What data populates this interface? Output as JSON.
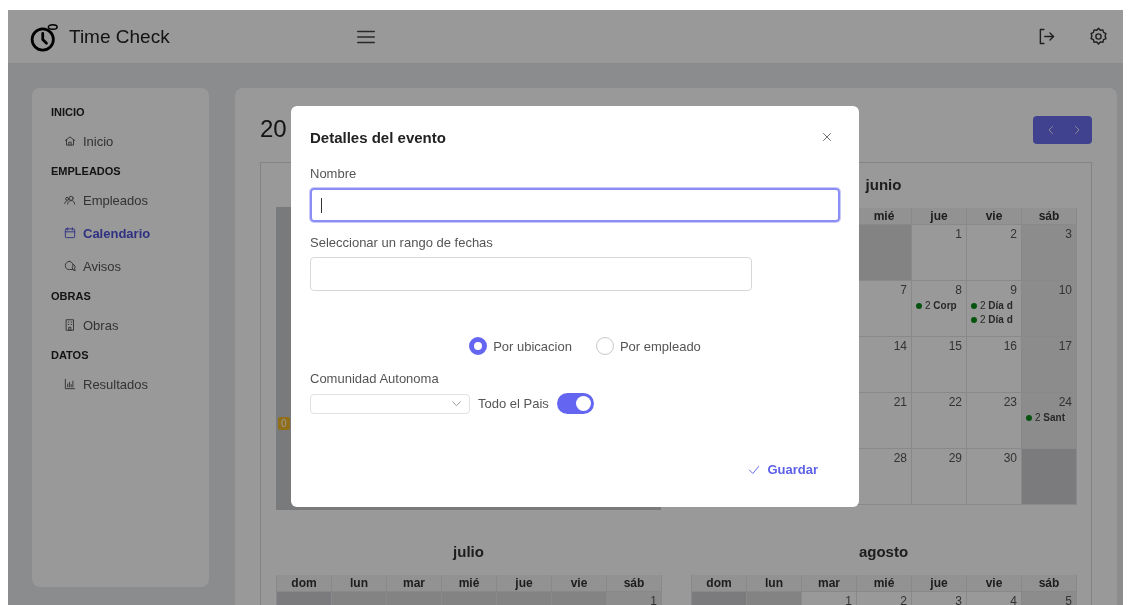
{
  "header": {
    "title": "Time Check"
  },
  "sidebar": {
    "sections": [
      {
        "heading": "INICIO",
        "items": [
          {
            "label": "Inicio",
            "selected": false
          }
        ]
      },
      {
        "heading": "EMPLEADOS",
        "items": [
          {
            "label": "Empleados",
            "selected": false
          },
          {
            "label": "Calendario",
            "selected": true
          },
          {
            "label": "Avisos",
            "selected": false
          }
        ]
      },
      {
        "heading": "OBRAS",
        "items": [
          {
            "label": "Obras",
            "selected": false
          }
        ]
      },
      {
        "heading": "DATOS",
        "items": [
          {
            "label": "Resultados",
            "selected": false
          }
        ]
      }
    ]
  },
  "main": {
    "year_title": "20"
  },
  "calendar": {
    "months": [
      {
        "kind": "covered",
        "badge": "0"
      },
      {
        "kind": "month",
        "name": "junio",
        "weekdays": [
          "mié",
          "jue",
          "vie",
          "sáb"
        ],
        "weeks": [
          [
            {
              "outside": true
            },
            {
              "day": "1",
              "outside": false
            },
            {
              "day": "2",
              "outside": false
            },
            {
              "day": "3",
              "outside": false
            }
          ],
          [
            {
              "day": "7",
              "outside": false
            },
            {
              "day": "8",
              "outside": false,
              "events": [
                "2 **Corp**"
              ]
            },
            {
              "day": "9",
              "outside": false,
              "events": [
                "2 **Día d**",
                "2 **Día d**"
              ]
            },
            {
              "day": "10",
              "outside": false
            }
          ],
          [
            {
              "day": "14",
              "outside": false
            },
            {
              "day": "15",
              "outside": false
            },
            {
              "day": "16",
              "outside": false
            },
            {
              "day": "17",
              "outside": false
            }
          ],
          [
            {
              "day": "21",
              "outside": false
            },
            {
              "day": "22",
              "outside": false
            },
            {
              "day": "23",
              "outside": false
            },
            {
              "day": "24",
              "outside": false,
              "events": [
                "2 **Sant**"
              ]
            }
          ],
          [
            {
              "day": "28",
              "outside": false
            },
            {
              "day": "29",
              "outside": false
            },
            {
              "day": "30",
              "outside": false
            },
            {
              "outside": true
            }
          ]
        ]
      },
      {
        "kind": "month",
        "name": "julio",
        "weekdays": [
          "dom",
          "lun",
          "mar",
          "mié",
          "jue",
          "vie",
          "sáb"
        ],
        "weeks": [
          [
            {
              "outside": true
            },
            {
              "outside": true
            },
            {
              "outside": true
            },
            {
              "outside": true
            },
            {
              "outside": true
            },
            {
              "outside": true
            },
            {
              "day": "1",
              "outside": false
            }
          ]
        ]
      },
      {
        "kind": "month",
        "name": "agosto",
        "weekdays": [
          "dom",
          "lun",
          "mar",
          "mié",
          "jue",
          "vie",
          "sáb"
        ],
        "weeks": [
          [
            {
              "outside": true
            },
            {
              "outside": true
            },
            {
              "day": "1",
              "outside": false
            },
            {
              "day": "2",
              "outside": false
            },
            {
              "day": "3",
              "outside": false
            },
            {
              "day": "4",
              "outside": false
            },
            {
              "day": "5",
              "outside": false
            }
          ]
        ]
      }
    ]
  },
  "modal": {
    "title": "Detalles del evento",
    "fields": [
      {
        "label": "Nombre",
        "focused": true
      },
      {
        "label": "Seleccionar un rango de fechas",
        "focused": false
      }
    ],
    "scope": {
      "options": [
        {
          "label": "Por ubicacion",
          "selected": true
        },
        {
          "label": "Por empleado",
          "selected": false
        }
      ]
    },
    "region": {
      "label": "Comunidad Autonoma"
    },
    "country_toggle": {
      "label": "Todo el Pais",
      "on": true
    },
    "save_button": "Guardar"
  }
}
